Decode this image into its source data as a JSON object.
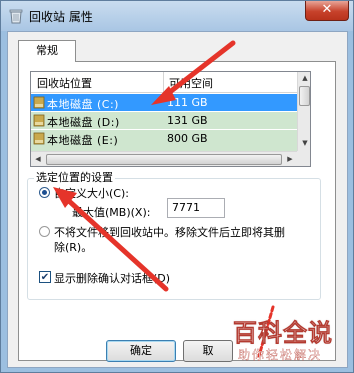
{
  "window": {
    "title": "回收站 属性",
    "close_label": "✕",
    "title_icon": "recycle-bin-icon"
  },
  "tabs": [
    {
      "label": "常规",
      "active": true
    }
  ],
  "list": {
    "columns": [
      "回收站位置",
      "可用空间"
    ],
    "rows": [
      {
        "name": "本地磁盘 (C:)",
        "size": "111 GB",
        "selected": true
      },
      {
        "name": "本地磁盘 (D:)",
        "size": "131 GB",
        "selected": false
      },
      {
        "name": "本地磁盘 (E:)",
        "size": "800 GB",
        "selected": false
      }
    ],
    "row_icon": "drive-icon",
    "selected_color": "#3399ff",
    "row_color": "#cfe6cf"
  },
  "settings": {
    "group_label": "选定位置的设置",
    "custom_size_label": "自定义大小(C):",
    "max_label": "最大值(MB)(X):",
    "max_value": "7771",
    "no_move_label_line1": "不将文件移到回收站中。移除文件后立即将其删",
    "no_move_label_line2": "除(R)。",
    "custom_selected": true
  },
  "confirm": {
    "label": "显示删除确认对话框(D)",
    "checked": true
  },
  "buttons": {
    "ok": "确定",
    "cancel": "取"
  },
  "watermark": {
    "main": "百科全说",
    "sub": "助你轻松解决"
  },
  "colors": {
    "annotation_arrow": "#e5342a",
    "watermark_bg": "#d9493f"
  }
}
